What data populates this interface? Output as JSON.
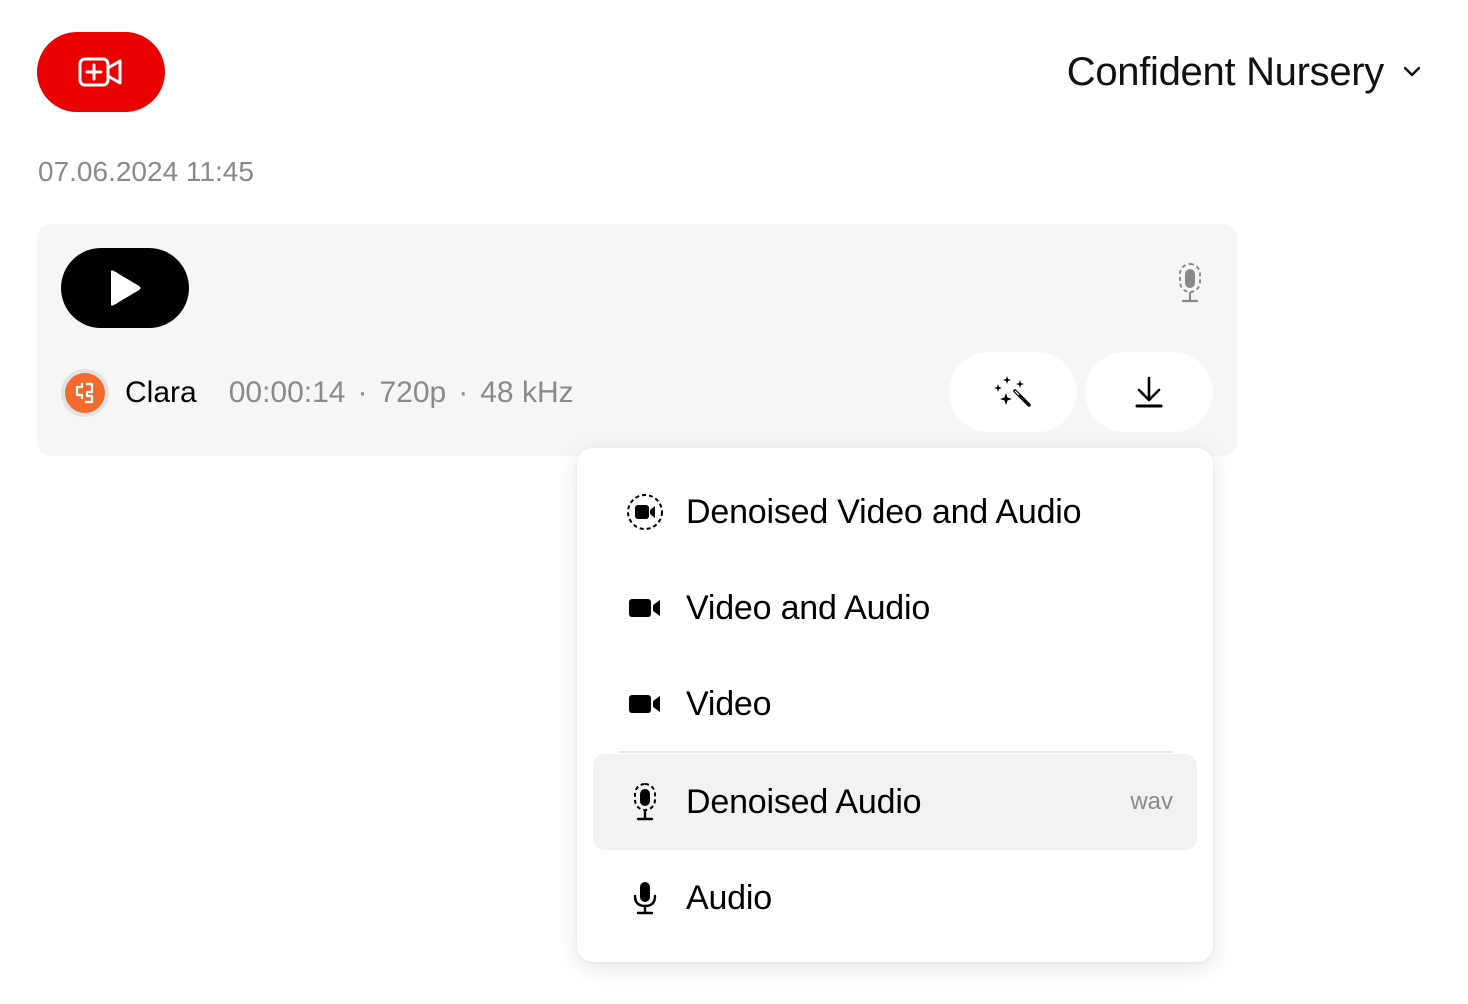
{
  "header": {
    "record_button_icon": "video-plus-icon",
    "project_name": "Confident Nursery",
    "project_chevron_icon": "chevron-down-icon"
  },
  "recording": {
    "date": "07.06.2024 11:45",
    "play_icon": "play-icon",
    "status_icon": "denoised-mic-icon",
    "user": {
      "name": "Clara",
      "avatar_icon": "avatar-glyph-icon",
      "avatar_color": "#f26a2e"
    },
    "duration": "00:00:14",
    "resolution": "720p",
    "sample_rate": "48 kHz",
    "separator": "·",
    "actions": {
      "enhance_icon": "magic-wand-icon",
      "download_icon": "download-icon"
    }
  },
  "download_menu": {
    "items": [
      {
        "label": "Denoised Video and Audio",
        "icon": "denoised-video-icon",
        "ext": ""
      },
      {
        "label": "Video and Audio",
        "icon": "video-icon",
        "ext": ""
      },
      {
        "label": "Video",
        "icon": "video-icon",
        "ext": ""
      },
      {
        "label": "Denoised Audio",
        "icon": "denoised-mic-icon",
        "ext": "wav",
        "highlighted": true
      },
      {
        "label": "Audio",
        "icon": "mic-icon",
        "ext": ""
      }
    ]
  },
  "colors": {
    "accent_red": "#eb0000",
    "card_bg": "#f6f6f6",
    "muted_text": "#8a8a8a",
    "highlight_bg": "#f2f2f2"
  }
}
